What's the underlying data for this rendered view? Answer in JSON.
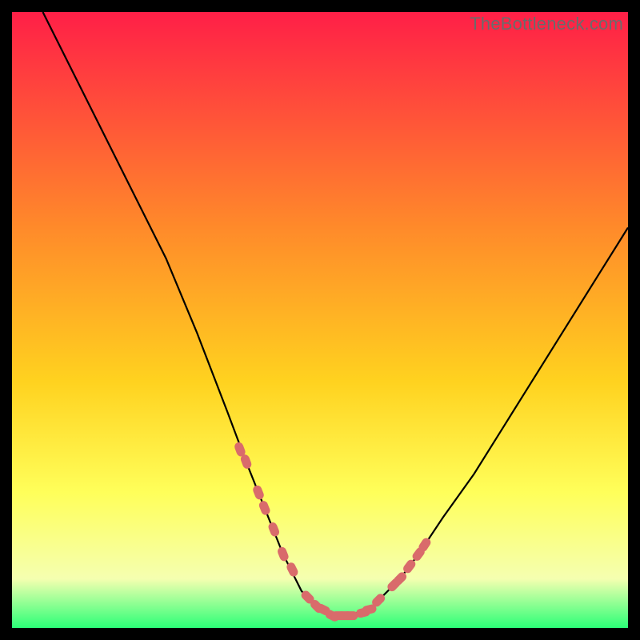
{
  "watermark": "TheBottleneck.com",
  "colors": {
    "gradient_top": "#ff1f47",
    "gradient_mid1": "#ff8a2a",
    "gradient_mid2": "#ffd21f",
    "gradient_mid3": "#ffff5a",
    "gradient_mid4": "#f5ffb0",
    "gradient_bottom": "#2bff77",
    "curve": "#000000",
    "marker": "#d96b6b"
  },
  "chart_data": {
    "type": "line",
    "title": "",
    "xlabel": "",
    "ylabel": "",
    "xlim": [
      0,
      100
    ],
    "ylim": [
      0,
      100
    ],
    "grid": false,
    "legend": false,
    "series": [
      {
        "name": "bottleneck-curve",
        "x": [
          5,
          10,
          15,
          20,
          25,
          30,
          35,
          38,
          40,
          42,
          44,
          45,
          46,
          47,
          48,
          49,
          50,
          51,
          52,
          53,
          54,
          55,
          56,
          58,
          60,
          63,
          66,
          70,
          75,
          80,
          85,
          90,
          95,
          100
        ],
        "y": [
          100,
          90,
          80,
          70,
          60,
          48,
          35,
          27,
          22,
          17,
          12,
          10,
          8,
          6,
          5,
          4,
          3,
          2.5,
          2,
          2,
          2,
          2,
          2.5,
          3,
          5,
          8,
          12,
          18,
          25,
          33,
          41,
          49,
          57,
          65
        ]
      }
    ],
    "markers": {
      "name": "highlight-points",
      "x": [
        37,
        38,
        40,
        41,
        42.5,
        44,
        45.5,
        48,
        49.5,
        50.5,
        52,
        53,
        54,
        55,
        57,
        58,
        59.5,
        62,
        63,
        64.5,
        66,
        67
      ],
      "y": [
        29,
        27,
        22,
        19.5,
        16,
        12,
        9.5,
        5,
        3.5,
        3,
        2,
        2,
        2,
        2,
        2.5,
        3,
        4.5,
        7,
        8,
        10,
        12,
        13.5
      ]
    }
  }
}
